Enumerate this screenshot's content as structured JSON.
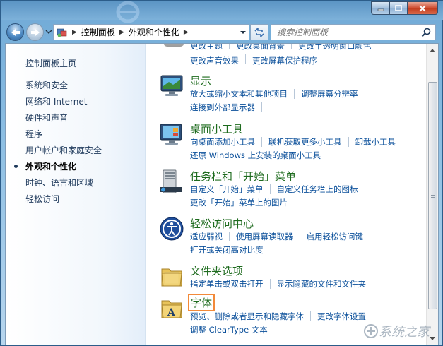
{
  "window": {
    "caption_buttons": [
      "minimize",
      "maximize",
      "close"
    ]
  },
  "nav": {
    "breadcrumbs": [
      "控制面板",
      "外观和个性化"
    ],
    "search_placeholder": "搜索控制面板"
  },
  "sidebar": {
    "home": "控制面板主页",
    "items": [
      {
        "label": "系统和安全",
        "active": false
      },
      {
        "label": "网络和 Internet",
        "active": false
      },
      {
        "label": "硬件和声音",
        "active": false
      },
      {
        "label": "程序",
        "active": false
      },
      {
        "label": "用户帐户和家庭安全",
        "active": false
      },
      {
        "label": "外观和个性化",
        "active": true
      },
      {
        "label": "时钟、语言和区域",
        "active": false
      },
      {
        "label": "轻松访问",
        "active": false
      }
    ]
  },
  "main": {
    "partial_top_links": [
      "更改主题",
      "更改桌面背景",
      "更改半透明窗口颜色",
      "更改声音效果",
      "更改屏幕保护程序"
    ],
    "categories": [
      {
        "title": "显示",
        "icon": "display-icon",
        "rows": [
          [
            "放大或缩小文本和其他项目",
            "调整屏幕分辨率"
          ],
          [
            "连接到外部显示器"
          ]
        ]
      },
      {
        "title": "桌面小工具",
        "icon": "gadgets-icon",
        "rows": [
          [
            "向桌面添加小工具",
            "联机获取更多小工具",
            "卸载小工具"
          ],
          [
            "还原 Windows 上安装的桌面小工具"
          ]
        ]
      },
      {
        "title": "任务栏和「开始」菜单",
        "icon": "taskbar-icon",
        "rows": [
          [
            "自定义「开始」菜单",
            "自定义任务栏上的图标"
          ],
          [
            "更改「开始」菜单上的图片"
          ]
        ]
      },
      {
        "title": "轻松访问中心",
        "icon": "ease-of-access-icon",
        "rows": [
          [
            "适应弱视",
            "使用屏幕读取器",
            "启用轻松访问键"
          ],
          [
            "打开或关闭高对比度"
          ]
        ]
      },
      {
        "title": "文件夹选项",
        "icon": "folder-options-icon",
        "rows": [
          [
            "指定单击或双击打开",
            "显示隐藏的文件和文件夹"
          ]
        ]
      },
      {
        "title": "字体",
        "icon": "fonts-icon",
        "highlighted": true,
        "rows": [
          [
            "预览、删除或者显示和隐藏字体",
            "更改字体设置"
          ],
          [
            "调整 ClearType 文本"
          ]
        ]
      }
    ]
  },
  "watermark": {
    "text": "系统之家"
  },
  "colors": {
    "link": "#0a4f9a",
    "category_title": "#1e6b1e",
    "highlight_box": "#f28a3a"
  }
}
